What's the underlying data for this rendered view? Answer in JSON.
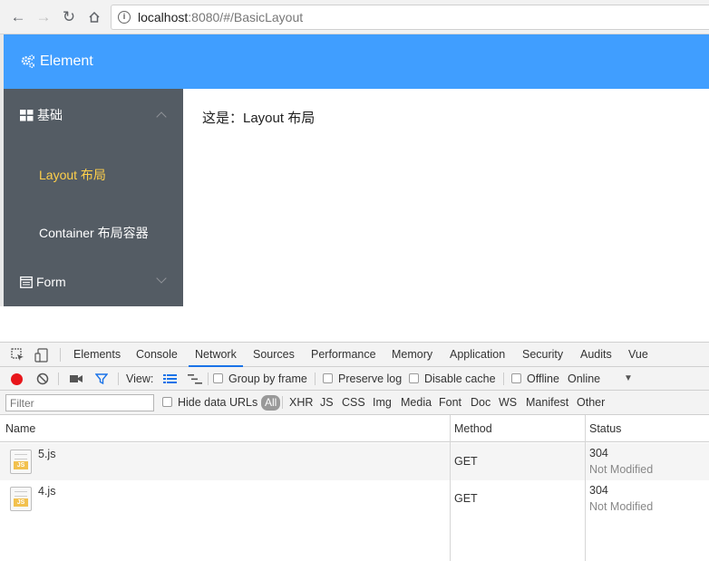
{
  "browser": {
    "url_host": "localhost",
    "url_rest": ":8080/#/BasicLayout"
  },
  "app": {
    "brand": "Element",
    "sidebar": {
      "group1_title": "基础",
      "item_layout": "Layout 布局",
      "item_container": "Container 布局容器",
      "group2_title": "Form"
    },
    "main_text": "这是：Layout 布局"
  },
  "devtools": {
    "tabs": [
      "Elements",
      "Console",
      "Network",
      "Sources",
      "Performance",
      "Memory",
      "Application",
      "Security",
      "Audits",
      "Vue"
    ],
    "active_tab": "Network",
    "toolbar": {
      "view_label": "View:",
      "group_by_frame": "Group by frame",
      "preserve_log": "Preserve log",
      "disable_cache": "Disable cache",
      "offline": "Offline",
      "throttle": "Online"
    },
    "filter": {
      "placeholder": "Filter",
      "hide_data_urls": "Hide data URLs",
      "types": [
        "All",
        "XHR",
        "JS",
        "CSS",
        "Img",
        "Media",
        "Font",
        "Doc",
        "WS",
        "Manifest",
        "Other"
      ]
    },
    "columns": [
      "Name",
      "Method",
      "Status"
    ],
    "rows": [
      {
        "name": "5.js",
        "method": "GET",
        "status_code": "304",
        "status_text": "Not Modified"
      },
      {
        "name": "4.js",
        "method": "GET",
        "status_code": "304",
        "status_text": "Not Modified"
      }
    ]
  },
  "colors": {
    "header": "#409eff",
    "sidebar": "#545c64",
    "active_item": "#ffd04b"
  }
}
